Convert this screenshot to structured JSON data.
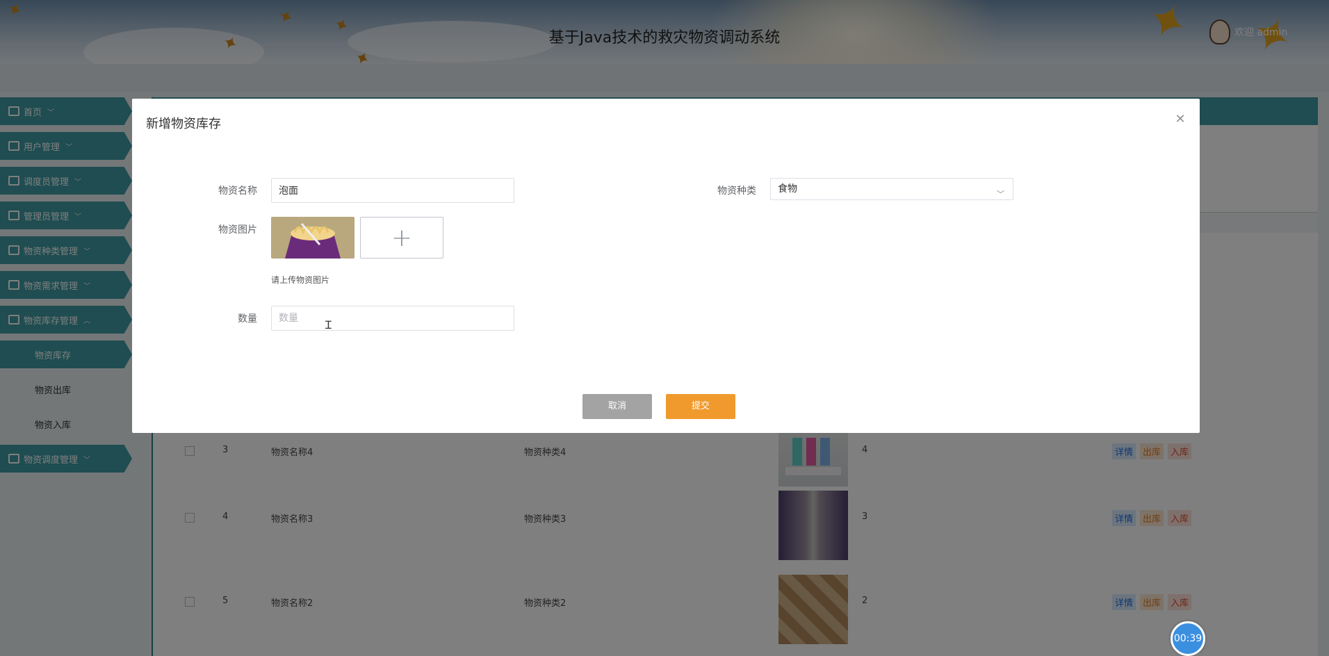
{
  "header": {
    "title": "基于Java技术的救灾物资调动系统",
    "welcome": "欢迎 admin"
  },
  "sidebar": {
    "items": [
      {
        "label": "首页",
        "icon": "home-icon"
      },
      {
        "label": "用户管理",
        "icon": "user-icon"
      },
      {
        "label": "调度员管理",
        "icon": "briefcase-icon"
      },
      {
        "label": "管理员管理",
        "icon": "card-icon"
      },
      {
        "label": "物资种类管理",
        "icon": "copy-icon"
      },
      {
        "label": "物资需求管理",
        "icon": "briefcase-icon"
      },
      {
        "label": "物资库存管理",
        "icon": "card-icon"
      }
    ],
    "sub_items": [
      "物资库存",
      "物资出库",
      "物资入库"
    ],
    "last_item": {
      "label": "物资调度管理",
      "icon": "doc-icon"
    }
  },
  "table": {
    "rows": [
      {
        "index": "3",
        "name": "物资名称4",
        "category": "物资种类4",
        "qty": "4"
      },
      {
        "index": "4",
        "name": "物资名称3",
        "category": "物资种类3",
        "qty": "3"
      },
      {
        "index": "5",
        "name": "物资名称2",
        "category": "物资种类2",
        "qty": "2"
      }
    ],
    "actions": {
      "detail": "详情",
      "out": "出库",
      "in": "入库"
    }
  },
  "dialog": {
    "title": "新增物资库存",
    "name_label": "物资名称",
    "name_value": "泡面",
    "category_label": "物资种类",
    "category_value": "食物",
    "image_label": "物资图片",
    "image_hint": "请上传物资图片",
    "qty_label": "数量",
    "qty_placeholder": "数量",
    "cancel": "取消",
    "submit": "提交"
  },
  "timer": "00:39",
  "colors": {
    "accent": "#3f9aa3",
    "submit": "#f09a2e",
    "cancel": "#a3a3a3"
  }
}
